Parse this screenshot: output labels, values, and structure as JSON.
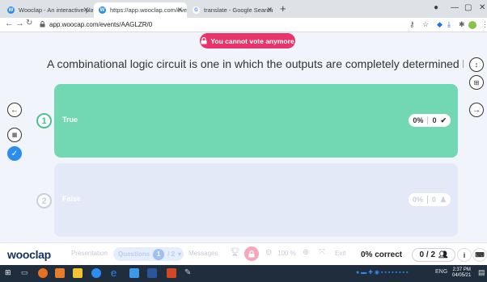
{
  "browser": {
    "tabs": [
      {
        "title": "Wooclap - An interactive platfo",
        "favicon_color": "#2d8cf0",
        "active": false
      },
      {
        "title": "https://app.wooclap.com/events",
        "favicon_color": "#2d8cf0",
        "active": true
      },
      {
        "title": "translate - Google Search",
        "favicon_color": "#4285f4",
        "active": false
      }
    ],
    "favicon_letters": [
      "W",
      "W",
      "G"
    ],
    "url": "app.woocap.com/events/AAGLZR/0"
  },
  "banner": {
    "text": "You cannot vote anymore",
    "color": "#e8336b"
  },
  "question": "A combinational logic circuit is one in which the outputs are completely determined by the ...",
  "answers": [
    {
      "num": "1",
      "label": "True",
      "percent": "0%",
      "count": "0",
      "status": "correct",
      "color": "#72d8b3",
      "label_color": "#ffffff",
      "num_color": "#4cc08f"
    },
    {
      "num": "2",
      "label": "False",
      "percent": "0%",
      "count": "0",
      "status": "incorrect",
      "color": "#e3e9f6",
      "label_color": "#ffffff",
      "num_color": "#c9cfdb"
    }
  ],
  "footer": {
    "logo": "wooclap",
    "presentation": "Presentation",
    "questions": "Questions",
    "question_num": "1",
    "question_total": "/ 2",
    "messages": "Messages",
    "zoom": "100 %",
    "exit": "Exit",
    "score": "0% correct",
    "votes": "0 / 2"
  },
  "taskbar": {
    "lang": "ENG",
    "time": "2:37 PM",
    "date": "04/05/21"
  },
  "colors": {
    "accent": "#2d8cf0",
    "navy": "#16315b"
  }
}
